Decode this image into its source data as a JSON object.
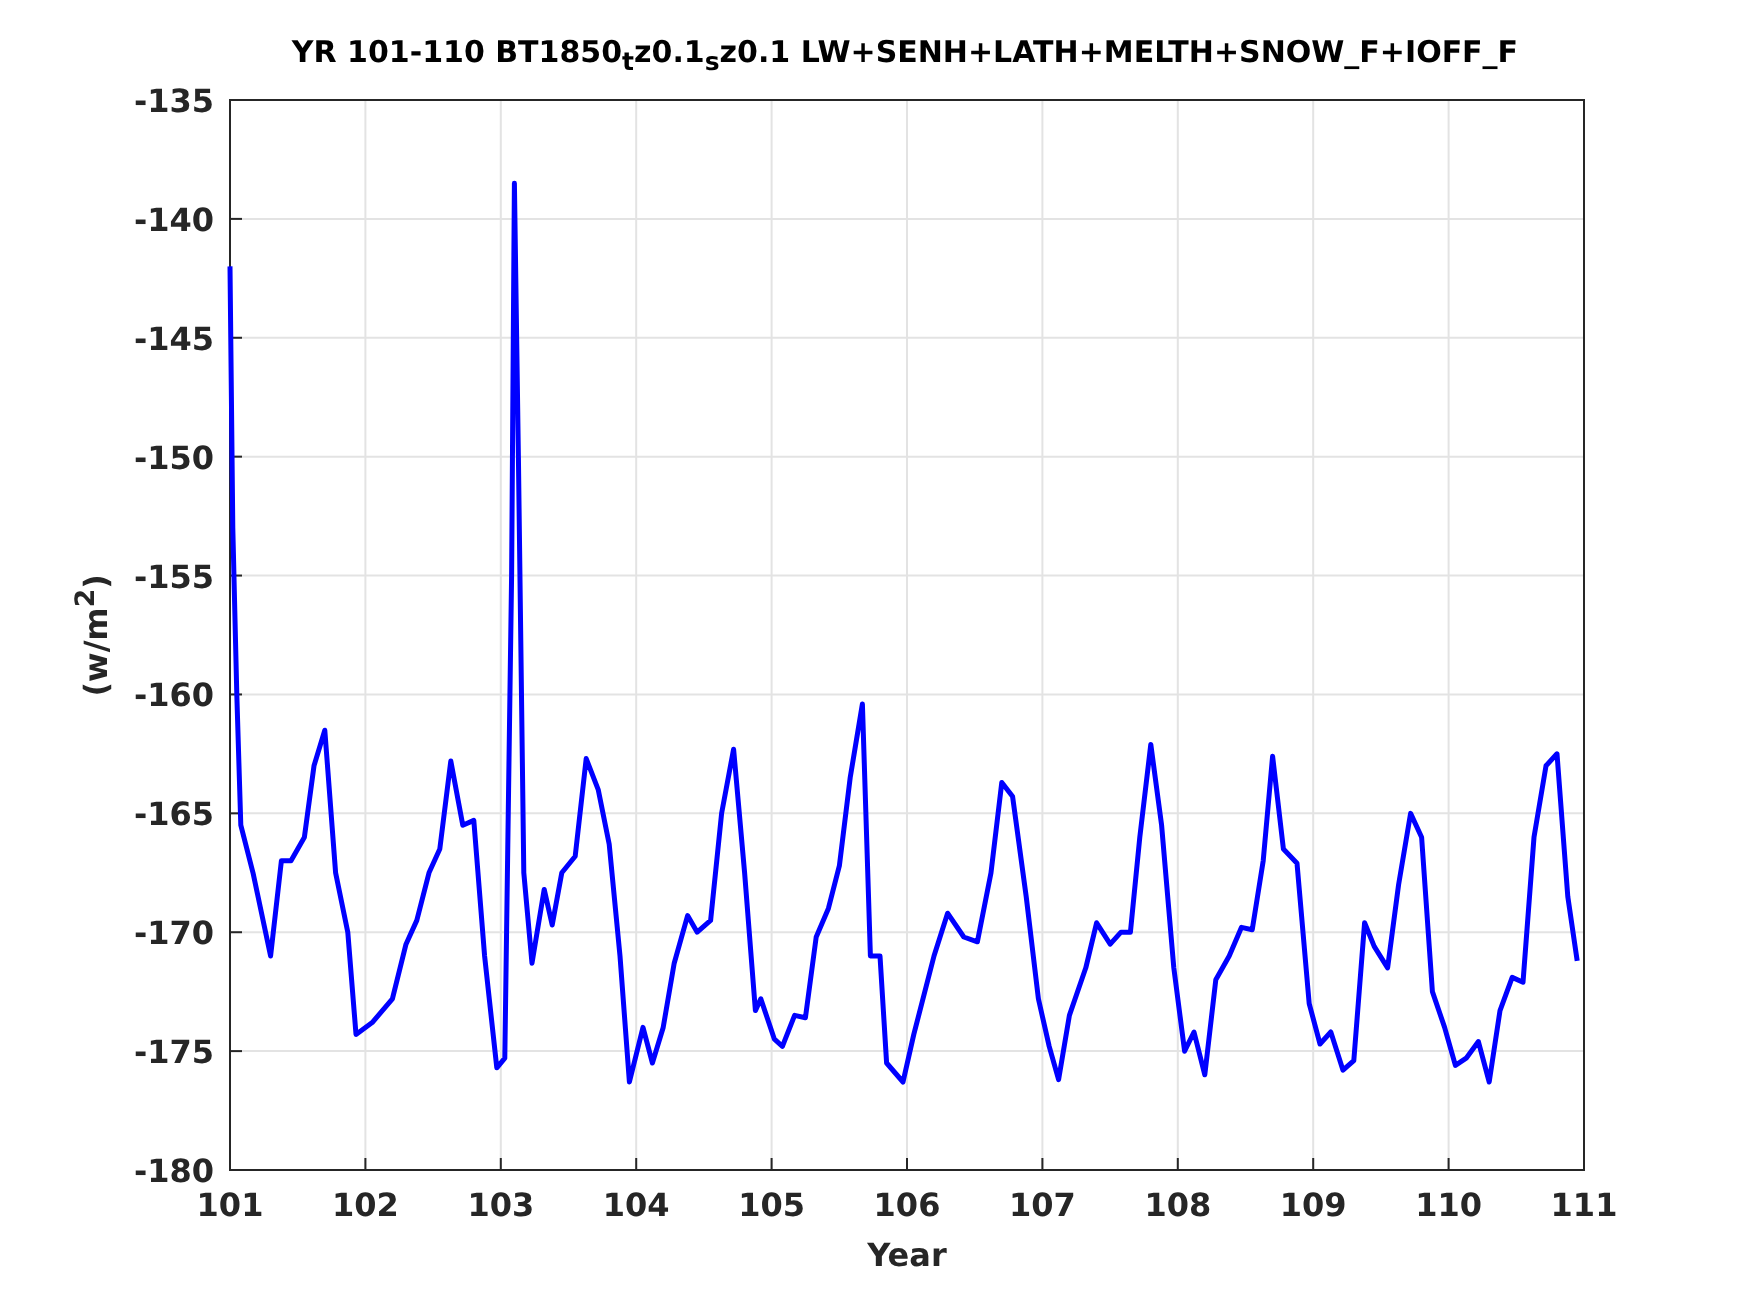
{
  "figure": {
    "chart_data": {
      "type": "line",
      "title": "YR 101-110 BT1850$_{t}$z0.1$_{s}$z0.1 LW+SENH+LATH+MELTH+SNOW_F+IOFF_F",
      "xlabel": "Year",
      "ylabel": "(w/m$^{2}$)",
      "xlim": [
        101,
        111
      ],
      "ylim": [
        -180,
        -135
      ],
      "xticks": [
        101,
        102,
        103,
        104,
        105,
        106,
        107,
        108,
        109,
        110,
        111
      ],
      "yticks": [
        -180,
        -175,
        -170,
        -165,
        -160,
        -155,
        -150,
        -145,
        -140,
        -135
      ],
      "x": [
        101.0,
        101.02,
        101.05,
        101.08,
        101.17,
        101.3,
        101.38,
        101.45,
        101.55,
        101.62,
        101.7,
        101.78,
        101.87,
        101.93,
        102.05,
        102.2,
        102.3,
        102.38,
        102.47,
        102.55,
        102.63,
        102.72,
        102.8,
        102.88,
        102.97,
        103.03,
        103.08,
        103.1,
        103.13,
        103.17,
        103.23,
        103.32,
        103.38,
        103.45,
        103.55,
        103.63,
        103.72,
        103.8,
        103.88,
        103.95,
        104.05,
        104.12,
        104.2,
        104.28,
        104.38,
        104.45,
        104.55,
        104.63,
        104.72,
        104.8,
        104.88,
        104.92,
        105.02,
        105.08,
        105.17,
        105.25,
        105.33,
        105.42,
        105.5,
        105.58,
        105.67,
        105.73,
        105.8,
        105.85,
        105.97,
        106.05,
        106.2,
        106.3,
        106.42,
        106.52,
        106.62,
        106.7,
        106.78,
        106.88,
        106.97,
        107.05,
        107.12,
        107.2,
        107.32,
        107.4,
        107.5,
        107.58,
        107.65,
        107.72,
        107.8,
        107.88,
        107.97,
        108.05,
        108.12,
        108.2,
        108.28,
        108.38,
        108.47,
        108.55,
        108.63,
        108.7,
        108.78,
        108.88,
        108.97,
        109.05,
        109.13,
        109.22,
        109.3,
        109.38,
        109.45,
        109.55,
        109.63,
        109.72,
        109.8,
        109.88,
        109.97,
        110.05,
        110.13,
        110.22,
        110.3,
        110.38,
        110.47,
        110.55,
        110.63,
        110.72,
        110.8,
        110.88,
        110.95
      ],
      "grid": true,
      "series": [
        {
          "color": "#0000ff",
          "values": [
            -142,
            -153,
            -160,
            -165.5,
            -167.5,
            -171,
            -167,
            -167,
            -166,
            -163,
            -161.5,
            -167.5,
            -170,
            -174.3,
            -173.8,
            -172.8,
            -170.5,
            -169.5,
            -167.5,
            -166.5,
            -162.8,
            -165.5,
            -165.3,
            -171,
            -175.7,
            -175.3,
            -155,
            -138.5,
            -150,
            -167.5,
            -171.3,
            -168.2,
            -169.7,
            -167.5,
            -166.8,
            -162.7,
            -164,
            -166.3,
            -171,
            -176.3,
            -174,
            -175.5,
            -174,
            -171.3,
            -169.3,
            -170,
            -169.5,
            -165,
            -162.3,
            -167.5,
            -173.3,
            -172.8,
            -174.5,
            -174.8,
            -173.5,
            -173.6,
            -170.2,
            -169,
            -167.2,
            -163.5,
            -160.4,
            -171,
            -171,
            -175.5,
            -176.3,
            -174.3,
            -171,
            -169.2,
            -170.2,
            -170.4,
            -167.5,
            -163.7,
            -164.3,
            -168.5,
            -172.8,
            -174.8,
            -176.2,
            -173.5,
            -171.5,
            -169.6,
            -170.5,
            -170,
            -170,
            -166,
            -162.1,
            -165.5,
            -171.5,
            -175,
            -174.2,
            -176,
            -172,
            -171,
            -169.8,
            -169.9,
            -167,
            -162.6,
            -166.5,
            -167.1,
            -173,
            -174.7,
            -174.2,
            -175.8,
            -175.4,
            -169.6,
            -170.6,
            -171.5,
            -168,
            -165,
            -166,
            -172.5,
            -174,
            -175.6,
            -175.3,
            -174.6,
            -176.3,
            -173.3,
            -171.9,
            -172.1,
            -166,
            -163,
            -162.5,
            -168.5,
            -171.2
          ]
        }
      ]
    }
  }
}
